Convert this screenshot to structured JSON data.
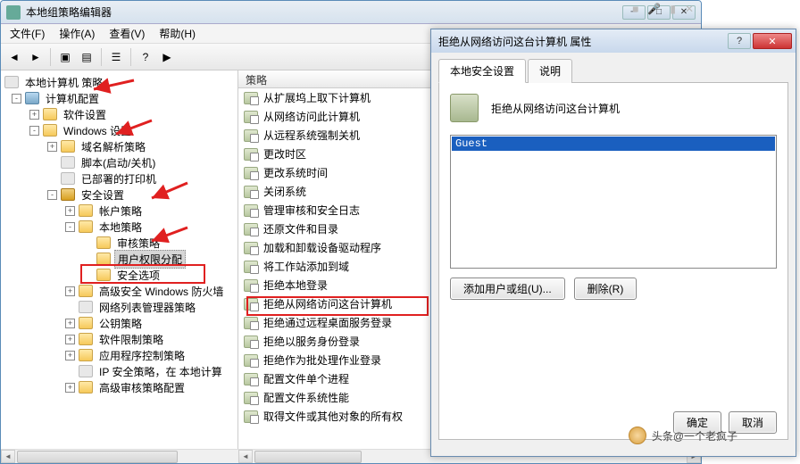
{
  "window": {
    "title": "本地组策略编辑器",
    "menus": [
      "文件(F)",
      "操作(A)",
      "查看(V)",
      "帮助(H)"
    ]
  },
  "tree": {
    "root": "本地计算机 策略",
    "computer_config": "计算机配置",
    "software_settings": "软件设置",
    "windows_settings": "Windows 设置",
    "dns_policy": "域名解析策略",
    "scripts": "脚本(启动/关机)",
    "printers": "已部署的打印机",
    "security_settings": "安全设置",
    "account_policy": "帐户策略",
    "local_policy": "本地策略",
    "audit_policy": "审核策略",
    "user_rights": "用户权限分配",
    "security_options": "安全选项",
    "firewall": "高级安全 Windows 防火墙",
    "netlist": "网络列表管理器策略",
    "public_key": "公钥策略",
    "software_restrict": "软件限制策略",
    "app_control": "应用程序控制策略",
    "ipsec": "IP 安全策略，在 本地计算",
    "adv_audit": "高级审核策略配置"
  },
  "list": {
    "header": "策略",
    "items": [
      "从扩展坞上取下计算机",
      "从网络访问此计算机",
      "从远程系统强制关机",
      "更改时区",
      "更改系统时间",
      "关闭系统",
      "管理审核和安全日志",
      "还原文件和目录",
      "加载和卸载设备驱动程序",
      "将工作站添加到域",
      "拒绝本地登录",
      "拒绝从网络访问这台计算机",
      "拒绝通过远程桌面服务登录",
      "拒绝以服务身份登录",
      "拒绝作为批处理作业登录",
      "配置文件单个进程",
      "配置文件系统性能",
      "取得文件或其他对象的所有权"
    ]
  },
  "dialog": {
    "title": "拒绝从网络访问这台计算机 属性",
    "tab1": "本地安全设置",
    "tab2": "说明",
    "prop_title": "拒绝从网络访问这台计算机",
    "list_item": "Guest",
    "add_btn": "添加用户或组(U)...",
    "remove_btn": "删除(R)",
    "ok": "确定",
    "cancel": "取消"
  },
  "watermark": "头条@一个老疯子"
}
